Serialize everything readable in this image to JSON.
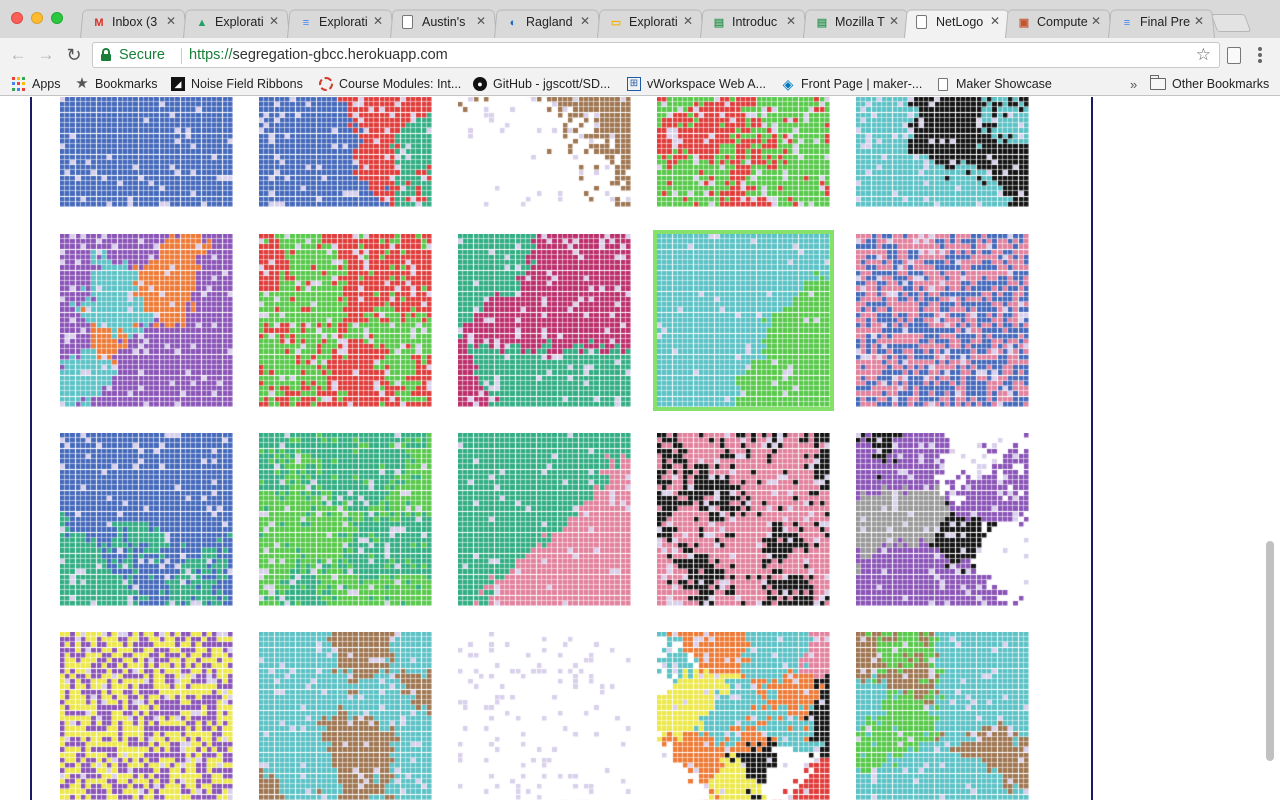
{
  "tabs": [
    {
      "title": "Inbox (3",
      "icon": "gmail-icon",
      "glyph": "M",
      "icon_color": "#d93025",
      "active": false
    },
    {
      "title": "Explorati",
      "icon": "google-drive-icon",
      "glyph": "▲",
      "icon_color": "#1fa463",
      "active": false
    },
    {
      "title": "Explorati",
      "icon": "google-docs-icon",
      "glyph": "≡",
      "icon_color": "#4285f4",
      "active": false
    },
    {
      "title": "Austin's",
      "icon": "page-icon",
      "glyph": "",
      "icon_color": "#777777",
      "active": false
    },
    {
      "title": "Ragland",
      "icon": "site-icon",
      "glyph": "◐",
      "icon_color": "#1565c0",
      "active": false
    },
    {
      "title": "Explorati",
      "icon": "google-slides-icon",
      "glyph": "▭",
      "icon_color": "#f4b400",
      "active": false
    },
    {
      "title": "Introduc",
      "icon": "document-icon",
      "glyph": "▤",
      "icon_color": "#3a9b5c",
      "active": false
    },
    {
      "title": "Mozilla T",
      "icon": "document-icon",
      "glyph": "▤",
      "icon_color": "#3a9b5c",
      "active": false
    },
    {
      "title": "NetLogo",
      "icon": "page-icon",
      "glyph": "",
      "icon_color": "#777777",
      "active": true
    },
    {
      "title": "Compute",
      "icon": "course-icon",
      "glyph": "▣",
      "icon_color": "#c2562c",
      "active": false
    },
    {
      "title": "Final Pre",
      "icon": "google-docs-icon",
      "glyph": "≡",
      "icon_color": "#4285f4",
      "active": false
    }
  ],
  "omnibox": {
    "security_label": "Secure",
    "scheme": "https://",
    "host": "segregation-gbcc.herokuapp.com"
  },
  "bookmarks": [
    {
      "label": "Apps",
      "icon": "apps-icon"
    },
    {
      "label": "Bookmarks",
      "icon": "star-icon"
    },
    {
      "label": "Noise Field Ribbons",
      "icon": "black-square-icon"
    },
    {
      "label": "Course Modules: Int...",
      "icon": "circle-logo-icon"
    },
    {
      "label": "GitHub - jgscott/SD...",
      "icon": "github-icon"
    },
    {
      "label": "vWorkspace Web A...",
      "icon": "grid-logo-icon"
    },
    {
      "label": "Front Page | maker-...",
      "icon": "drupal-icon"
    },
    {
      "label": "Maker Showcase",
      "icon": "page-icon"
    }
  ],
  "bookmarks_overflow": "»",
  "other_bookmarks": "Other Bookmarks",
  "colors": {
    "blue": "#4569bb",
    "red": "#e03c3a",
    "green": "#58c94a",
    "teal": "#33ae84",
    "cyan": "#5bc2c6",
    "pink": "#e2829e",
    "magenta": "#bb2f6c",
    "purple": "#8b55b8",
    "orange": "#ee7a36",
    "brown": "#9f7753",
    "gray": "#9a9a9a",
    "black": "#141414",
    "yellow": "#ede84b",
    "empty": "#d9d0ec",
    "white": "#ffffff",
    "selected_outline": "#86e06c"
  },
  "tiles": [
    {
      "colors": [
        "blue"
      ],
      "empty": 0.06,
      "mode": "solid",
      "seed": 11
    },
    {
      "colors": [
        "red",
        "blue",
        "teal"
      ],
      "empty": 0.08,
      "mode": "blob",
      "seed": 21
    },
    {
      "colors": [
        "brown",
        "white",
        "black"
      ],
      "empty": 0.05,
      "mode": "region",
      "seed": 31
    },
    {
      "colors": [
        "red",
        "green"
      ],
      "empty": 0.1,
      "mode": "mixed",
      "seed": 41
    },
    {
      "colors": [
        "cyan",
        "magenta",
        "black",
        "pink",
        "purple",
        "blue"
      ],
      "empty": 0.06,
      "mode": "blob",
      "seed": 51
    },
    {
      "colors": [
        "purple",
        "cyan",
        "orange"
      ],
      "empty": 0.06,
      "mode": "blob",
      "seed": 61
    },
    {
      "colors": [
        "red",
        "green"
      ],
      "empty": 0.08,
      "mode": "mixed",
      "seed": 71
    },
    {
      "colors": [
        "magenta",
        "teal"
      ],
      "empty": 0.07,
      "mode": "blob",
      "seed": 81
    },
    {
      "colors": [
        "cyan",
        "green"
      ],
      "empty": 0.03,
      "mode": "region",
      "seed": 91,
      "selected": true
    },
    {
      "colors": [
        "pink",
        "blue"
      ],
      "empty": 0.06,
      "mode": "noise",
      "seed": 101
    },
    {
      "colors": [
        "blue",
        "teal"
      ],
      "empty": 0.06,
      "mode": "blob",
      "seed": 111
    },
    {
      "colors": [
        "green",
        "teal"
      ],
      "empty": 0.08,
      "mode": "mixed",
      "seed": 121
    },
    {
      "colors": [
        "pink",
        "teal"
      ],
      "empty": 0.05,
      "mode": "region",
      "seed": 131
    },
    {
      "colors": [
        "black",
        "pink"
      ],
      "empty": 0.08,
      "mode": "mixed",
      "seed": 141
    },
    {
      "colors": [
        "gray",
        "black",
        "white",
        "purple"
      ],
      "empty": 0.08,
      "mode": "blob",
      "seed": 151
    },
    {
      "colors": [
        "yellow",
        "purple"
      ],
      "empty": 0.06,
      "mode": "noise",
      "seed": 161
    },
    {
      "colors": [
        "cyan",
        "brown"
      ],
      "empty": 0.06,
      "mode": "blob",
      "seed": 171
    },
    {
      "colors": [
        "white"
      ],
      "empty": 0.1,
      "mode": "solid",
      "seed": 181
    },
    {
      "colors": [
        "green",
        "pink",
        "yellow",
        "white",
        "black",
        "orange",
        "cyan",
        "red"
      ],
      "empty": 0.06,
      "mode": "patch",
      "seed": 191
    },
    {
      "colors": [
        "green",
        "brown",
        "cyan"
      ],
      "empty": 0.06,
      "mode": "blob",
      "seed": 201
    }
  ]
}
